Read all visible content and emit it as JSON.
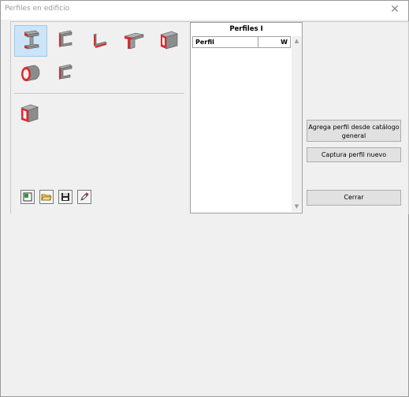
{
  "window": {
    "title": "Perfiles en edificio",
    "close_icon": "close-icon"
  },
  "palette": {
    "icons": [
      {
        "name": "i-beam-profile-icon",
        "selected": true
      },
      {
        "name": "channel-profile-icon"
      },
      {
        "name": "angle-profile-icon"
      },
      {
        "name": "tee-profile-icon"
      },
      {
        "name": "rectangular-tube-profile-icon"
      },
      {
        "name": "circular-tube-profile-icon"
      },
      {
        "name": "zee-profile-icon"
      },
      {
        "name": "box-section-profile-icon"
      }
    ],
    "tools": [
      "new-icon",
      "open-folder-icon",
      "save-disk-icon",
      "edit-pencil-icon"
    ]
  },
  "list": {
    "title": "Perfiles I",
    "columns": [
      "Perfil",
      "W"
    ],
    "rows": []
  },
  "buttons": {
    "add_from_catalog": "Agrega perfil desde catálogo general",
    "capture_new": "Captura perfil nuevo",
    "close": "Cerrar"
  },
  "colors": {
    "accent": "#e0282e",
    "steel": "#8c8c8c",
    "selected": "#cce4f7"
  }
}
